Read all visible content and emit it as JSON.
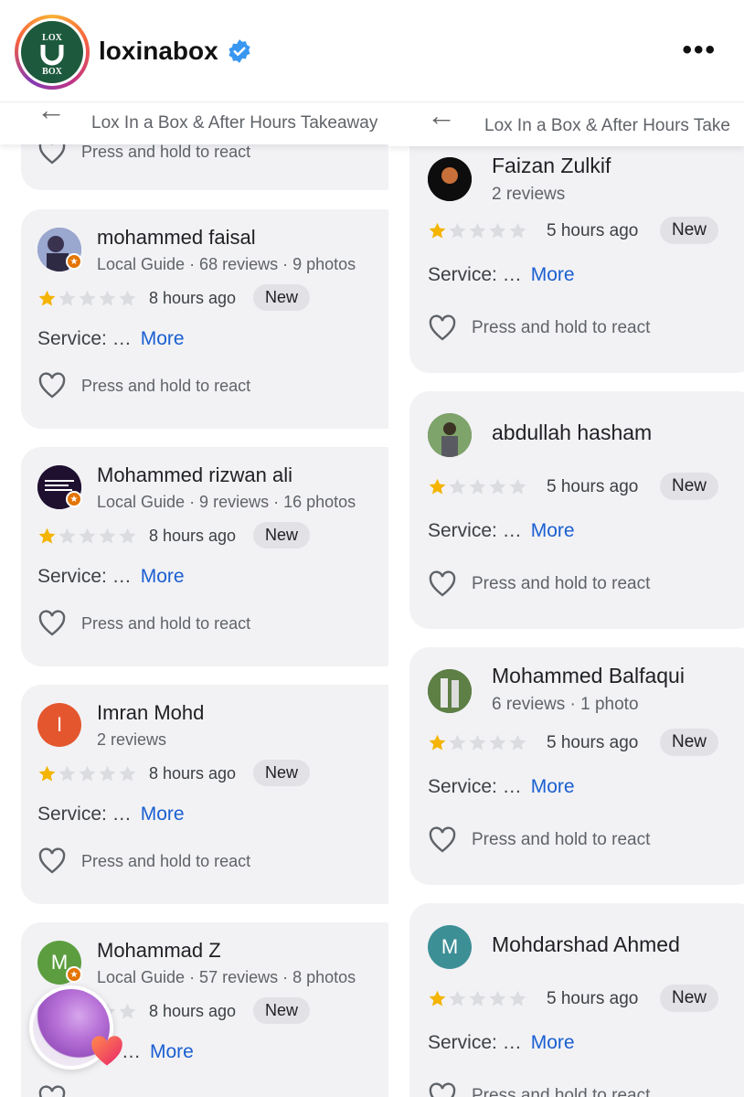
{
  "header": {
    "username": "loxinabox",
    "logo_text_top": "LOX",
    "logo_text_bottom": "BOX",
    "more_label": "•••"
  },
  "left_panel": {
    "back_icon": "arrow-left-icon",
    "title": "Lox In a Box & After Hours Takeaway",
    "partial_react": "Press and hold to react",
    "reviews": [
      {
        "name": "mohammed faisal",
        "meta": "Local Guide · 68 reviews · 9 photos",
        "time": "8 hours ago",
        "new_label": "New",
        "service": "Service: …",
        "more": "More",
        "react": "Press and hold to react",
        "avatar_color": "#6d7aa8"
      },
      {
        "name": "Mohammed rizwan ali",
        "meta": "Local Guide · 9 reviews · 16 photos",
        "time": "8 hours ago",
        "new_label": "New",
        "service": "Service: …",
        "more": "More",
        "react": "Press and hold to react",
        "avatar_color": "#1f1030"
      },
      {
        "name": "Imran Mohd",
        "meta": "2 reviews",
        "time": "8 hours ago",
        "new_label": "New",
        "service": "Service: …",
        "more": "More",
        "react": "Press and hold to react",
        "avatar_color": "#e4572e",
        "avatar_letter": "I"
      },
      {
        "name": "Mohammad Z",
        "meta": "Local Guide · 57 reviews · 8 photos",
        "time": "8 hours ago",
        "new_label": "New",
        "service": "…",
        "more": "More",
        "react": "Press and hold to react",
        "avatar_color": "#5c9e3f",
        "avatar_letter": "M"
      }
    ]
  },
  "right_panel": {
    "back_icon": "arrow-left-icon",
    "title": "Lox In a Box & After Hours Take",
    "reviews": [
      {
        "name": "Faizan Zulkif",
        "meta": "2 reviews",
        "time": "5 hours ago",
        "new_label": "New",
        "service": "Service: …",
        "more": "More",
        "react": "Press and hold to react",
        "avatar_color": "#0d0d0d"
      },
      {
        "name": "abdullah hasham",
        "meta": "",
        "time": "5 hours ago",
        "new_label": "New",
        "service": "Service: …",
        "more": "More",
        "react": "Press and hold to react",
        "avatar_color": "#6a8a5c"
      },
      {
        "name": "Mohammed Balfaqui",
        "meta": "6 reviews · 1 photo",
        "time": "5 hours ago",
        "new_label": "New",
        "service": "Service: …",
        "more": "More",
        "react": "Press and hold to react",
        "avatar_color": "#4c6b3d"
      },
      {
        "name": "Mohdarshad Ahmed",
        "meta": "",
        "time": "5 hours ago",
        "new_label": "New",
        "service": "Service: …",
        "more": "More",
        "react": "Press and hold to react",
        "avatar_color": "#3d8f96",
        "avatar_letter": "M"
      }
    ]
  },
  "rating": {
    "stars_filled": 1,
    "stars_total": 5,
    "filled_color": "#f4b400",
    "empty_color": "#dadce0"
  },
  "colors": {
    "link": "#1a5fd0",
    "card_bg": "#f2f2f5",
    "verified": "#3897f0"
  }
}
